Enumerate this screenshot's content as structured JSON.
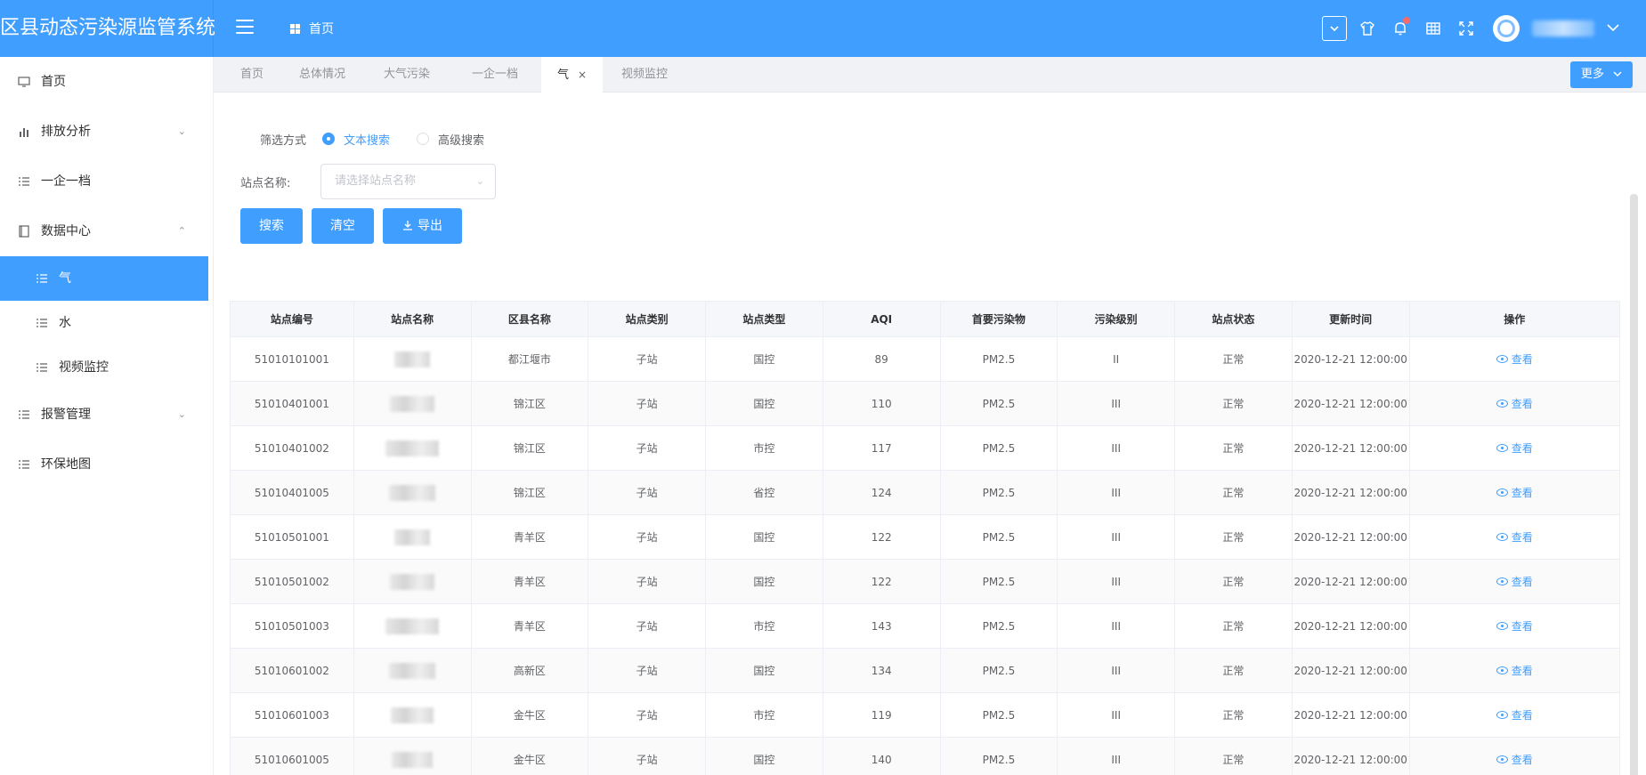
{
  "header": {
    "title": "区县动态污染源监管系统",
    "breadcrumb": "首页"
  },
  "sidebar": {
    "items": [
      {
        "label": "首页",
        "icon": "monitor-icon"
      },
      {
        "label": "排放分析",
        "icon": "bar-chart-icon",
        "caret": "down"
      },
      {
        "label": "一企一档",
        "icon": "list-icon"
      },
      {
        "label": "数据中心",
        "icon": "book-icon",
        "caret": "up"
      },
      {
        "label": "报警管理",
        "icon": "list-icon",
        "caret": "down"
      },
      {
        "label": "环保地图",
        "icon": "list-icon"
      }
    ],
    "sub_items": [
      {
        "label": "气",
        "active": true
      },
      {
        "label": "水"
      },
      {
        "label": "视频监控"
      }
    ]
  },
  "tabs": [
    {
      "label": "首页"
    },
    {
      "label": "总体情况"
    },
    {
      "label": "大气污染"
    },
    {
      "label": "一企一档"
    },
    {
      "label": "气",
      "active": true,
      "close": "×"
    },
    {
      "label": "视频监控"
    }
  ],
  "more_button": "更多",
  "filter": {
    "label": "筛选方式",
    "option_text": "文本搜索",
    "option_advanced": "高级搜索"
  },
  "site": {
    "label": "站点名称:",
    "placeholder": "请选择站点名称"
  },
  "buttons": {
    "search": "搜索",
    "clear": "清空",
    "export": "导出"
  },
  "table": {
    "columns": [
      "站点编号",
      "站点名称",
      "区县名称",
      "站点类别",
      "站点类型",
      "AQI",
      "首要污染物",
      "污染级别",
      "站点状态",
      "更新时间",
      "操作"
    ],
    "action_label": "查看",
    "rows": [
      {
        "code": "51010101001",
        "district": "都江堰市",
        "category": "子站",
        "type": "国控",
        "aqi": "89",
        "pollutant": "PM2.5",
        "level": "II",
        "status": "正常",
        "time": "2020-12-21 12:00:00"
      },
      {
        "code": "51010401001",
        "district": "锦江区",
        "category": "子站",
        "type": "国控",
        "aqi": "110",
        "pollutant": "PM2.5",
        "level": "III",
        "status": "正常",
        "time": "2020-12-21 12:00:00"
      },
      {
        "code": "51010401002",
        "district": "锦江区",
        "category": "子站",
        "type": "市控",
        "aqi": "117",
        "pollutant": "PM2.5",
        "level": "III",
        "status": "正常",
        "time": "2020-12-21 12:00:00"
      },
      {
        "code": "51010401005",
        "district": "锦江区",
        "category": "子站",
        "type": "省控",
        "aqi": "124",
        "pollutant": "PM2.5",
        "level": "III",
        "status": "正常",
        "time": "2020-12-21 12:00:00"
      },
      {
        "code": "51010501001",
        "district": "青羊区",
        "category": "子站",
        "type": "国控",
        "aqi": "122",
        "pollutant": "PM2.5",
        "level": "III",
        "status": "正常",
        "time": "2020-12-21 12:00:00"
      },
      {
        "code": "51010501002",
        "district": "青羊区",
        "category": "子站",
        "type": "国控",
        "aqi": "122",
        "pollutant": "PM2.5",
        "level": "III",
        "status": "正常",
        "time": "2020-12-21 12:00:00"
      },
      {
        "code": "51010501003",
        "district": "青羊区",
        "category": "子站",
        "type": "市控",
        "aqi": "143",
        "pollutant": "PM2.5",
        "level": "III",
        "status": "正常",
        "time": "2020-12-21 12:00:00"
      },
      {
        "code": "51010601002",
        "district": "高新区",
        "category": "子站",
        "type": "国控",
        "aqi": "134",
        "pollutant": "PM2.5",
        "level": "III",
        "status": "正常",
        "time": "2020-12-21 12:00:00"
      },
      {
        "code": "51010601003",
        "district": "金牛区",
        "category": "子站",
        "type": "市控",
        "aqi": "119",
        "pollutant": "PM2.5",
        "level": "III",
        "status": "正常",
        "time": "2020-12-21 12:00:00"
      },
      {
        "code": "51010601005",
        "district": "金牛区",
        "category": "子站",
        "type": "国控",
        "aqi": "140",
        "pollutant": "PM2.5",
        "level": "III",
        "status": "正常",
        "time": "2020-12-21 12:00:00"
      }
    ]
  },
  "colors": {
    "primary": "#409eff",
    "badge": "#f56c6c"
  }
}
